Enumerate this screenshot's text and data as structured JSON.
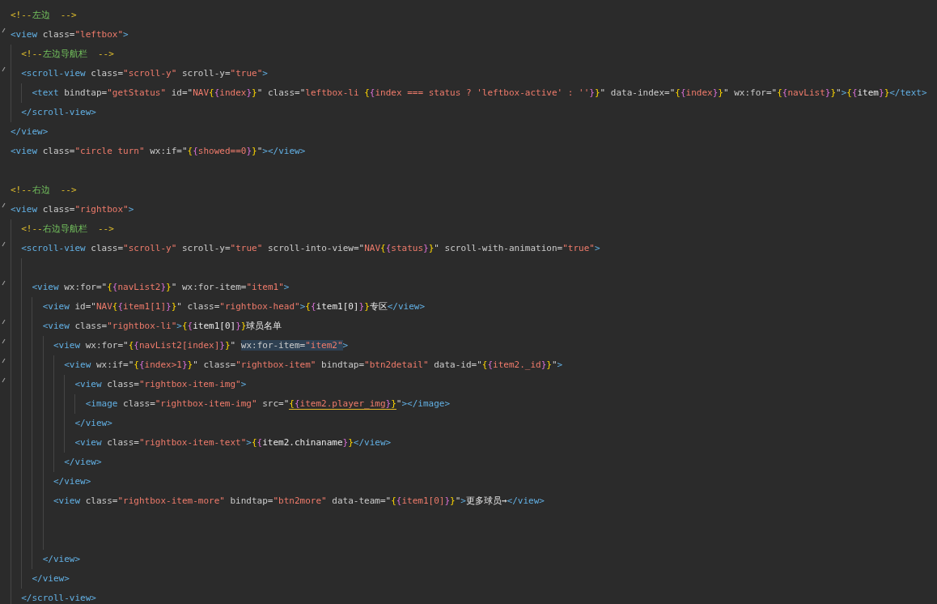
{
  "editor": {
    "lines": [
      {
        "gutter_mark": false,
        "tokens": [
          {
            "kind": "cm",
            "text": "<!--"
          },
          {
            "kind": "ct",
            "text": "左边"
          },
          {
            "kind": "cm",
            "text": "  -->"
          }
        ]
      },
      {
        "gutter_mark": true,
        "tokens": [
          {
            "kind": "tag",
            "text": "<view"
          },
          {
            "kind": "attr",
            "text": " class="
          },
          {
            "kind": "str",
            "text": "\"leftbox\""
          },
          {
            "kind": "tag",
            "text": ">"
          }
        ],
        "children": [
          {
            "gutter_mark": false,
            "tokens": [
              {
                "kind": "cm",
                "text": "<!--"
              },
              {
                "kind": "ct",
                "text": "左边导航栏"
              },
              {
                "kind": "cm",
                "text": "  -->"
              }
            ]
          },
          {
            "gutter_mark": true,
            "tokens": [
              {
                "kind": "tag",
                "text": "<scroll-view"
              },
              {
                "kind": "attr",
                "text": " class="
              },
              {
                "kind": "str",
                "text": "\"scroll-y\""
              },
              {
                "kind": "attr",
                "text": " scroll-y="
              },
              {
                "kind": "str",
                "text": "\"true\""
              },
              {
                "kind": "tag",
                "text": ">"
              }
            ],
            "children": [
              {
                "gutter_mark": false,
                "tokens": [
                  {
                    "kind": "tag",
                    "text": "<text"
                  },
                  {
                    "kind": "attr",
                    "text": " bindtap="
                  },
                  {
                    "kind": "str",
                    "text": "\"getStatus\""
                  },
                  {
                    "kind": "attr",
                    "text": " id=\""
                  },
                  {
                    "kind": "str",
                    "text": "NAV"
                  },
                  {
                    "kind": "open",
                    "text": "{{"
                  },
                  {
                    "kind": "str",
                    "text": "index"
                  },
                  {
                    "kind": "close",
                    "text": "}}"
                  },
                  {
                    "kind": "attr",
                    "text": "\" class=\""
                  },
                  {
                    "kind": "str",
                    "text": "leftbox-li "
                  },
                  {
                    "kind": "open",
                    "text": "{{"
                  },
                  {
                    "kind": "str",
                    "text": "index === status ? 'leftbox-active' : ''"
                  },
                  {
                    "kind": "close",
                    "text": "}}"
                  },
                  {
                    "kind": "attr",
                    "text": "\" data-index=\""
                  },
                  {
                    "kind": "open",
                    "text": "{{"
                  },
                  {
                    "kind": "str",
                    "text": "index"
                  },
                  {
                    "kind": "close",
                    "text": "}}"
                  },
                  {
                    "kind": "attr",
                    "text": "\" wx:for=\""
                  },
                  {
                    "kind": "open",
                    "text": "{{"
                  },
                  {
                    "kind": "str",
                    "text": "navList"
                  },
                  {
                    "kind": "close",
                    "text": "}}"
                  },
                  {
                    "kind": "attr",
                    "text": "\""
                  },
                  {
                    "kind": "tag",
                    "text": ">"
                  },
                  {
                    "kind": "open",
                    "text": "{{"
                  },
                  {
                    "kind": "text",
                    "text": "item"
                  },
                  {
                    "kind": "close",
                    "text": "}}"
                  },
                  {
                    "kind": "tag",
                    "text": "</text>"
                  }
                ]
              }
            ]
          },
          {
            "gutter_mark": false,
            "tokens": [
              {
                "kind": "tag",
                "text": "</scroll-view>"
              }
            ]
          }
        ]
      },
      {
        "gutter_mark": false,
        "tokens": [
          {
            "kind": "tag",
            "text": "</view>"
          }
        ]
      },
      {
        "gutter_mark": false,
        "tokens": [
          {
            "kind": "tag",
            "text": "<view"
          },
          {
            "kind": "attr",
            "text": " class="
          },
          {
            "kind": "str",
            "text": "\"circle turn\""
          },
          {
            "kind": "attr",
            "text": " wx:if=\""
          },
          {
            "kind": "open",
            "text": "{{"
          },
          {
            "kind": "str",
            "text": "showed==0"
          },
          {
            "kind": "close",
            "text": "}}"
          },
          {
            "kind": "attr",
            "text": "\""
          },
          {
            "kind": "tag",
            "text": "></view>"
          }
        ]
      },
      {
        "gutter_mark": false
      },
      {
        "gutter_mark": false,
        "tokens": [
          {
            "kind": "cm",
            "text": "<!--"
          },
          {
            "kind": "ct",
            "text": "右边"
          },
          {
            "kind": "cm",
            "text": "  -->"
          }
        ]
      },
      {
        "gutter_mark": true,
        "tokens": [
          {
            "kind": "tag",
            "text": "<view"
          },
          {
            "kind": "attr",
            "text": " class="
          },
          {
            "kind": "str",
            "text": "\"rightbox\""
          },
          {
            "kind": "tag",
            "text": ">"
          }
        ],
        "children": [
          {
            "gutter_mark": false,
            "tokens": [
              {
                "kind": "cm",
                "text": "<!--"
              },
              {
                "kind": "ct",
                "text": "右边导航栏"
              },
              {
                "kind": "cm",
                "text": "  -->"
              }
            ]
          },
          {
            "gutter_mark": true,
            "tokens": [
              {
                "kind": "tag",
                "text": "<scroll-view"
              },
              {
                "kind": "attr",
                "text": " class="
              },
              {
                "kind": "str",
                "text": "\"scroll-y\""
              },
              {
                "kind": "attr",
                "text": " scroll-y="
              },
              {
                "kind": "str",
                "text": "\"true\""
              },
              {
                "kind": "attr",
                "text": " scroll-into-view=\""
              },
              {
                "kind": "str",
                "text": "NAV"
              },
              {
                "kind": "open",
                "text": "{{"
              },
              {
                "kind": "str",
                "text": "status"
              },
              {
                "kind": "close",
                "text": "}}"
              },
              {
                "kind": "attr",
                "text": "\" scroll-with-animation="
              },
              {
                "kind": "str",
                "text": "\"true\""
              },
              {
                "kind": "tag",
                "text": ">"
              }
            ],
            "children": [
              {
                "gutter_mark": false
              },
              {
                "gutter_mark": true,
                "tokens": [
                  {
                    "kind": "tag",
                    "text": "<view"
                  },
                  {
                    "kind": "attr",
                    "text": " wx:for=\""
                  },
                  {
                    "kind": "open",
                    "text": "{{"
                  },
                  {
                    "kind": "str",
                    "text": "navList2"
                  },
                  {
                    "kind": "close",
                    "text": "}}"
                  },
                  {
                    "kind": "attr",
                    "text": "\" wx:for-item="
                  },
                  {
                    "kind": "str",
                    "text": "\"item1\""
                  },
                  {
                    "kind": "tag",
                    "text": ">"
                  }
                ],
                "children": [
                  {
                    "gutter_mark": false,
                    "tokens": [
                      {
                        "kind": "tag",
                        "text": "<view"
                      },
                      {
                        "kind": "attr",
                        "text": " id=\""
                      },
                      {
                        "kind": "str",
                        "text": "NAV"
                      },
                      {
                        "kind": "open",
                        "text": "{{"
                      },
                      {
                        "kind": "str",
                        "text": "item1[1]"
                      },
                      {
                        "kind": "close",
                        "text": "}}"
                      },
                      {
                        "kind": "attr",
                        "text": "\" class="
                      },
                      {
                        "kind": "str",
                        "text": "\"rightbox-head\""
                      },
                      {
                        "kind": "tag",
                        "text": ">"
                      },
                      {
                        "kind": "open",
                        "text": "{{"
                      },
                      {
                        "kind": "text",
                        "text": "item1[0]"
                      },
                      {
                        "kind": "close",
                        "text": "}}"
                      },
                      {
                        "kind": "text",
                        "text": "专区"
                      },
                      {
                        "kind": "tag",
                        "text": "</view>"
                      }
                    ]
                  },
                  {
                    "gutter_mark": true,
                    "tokens": [
                      {
                        "kind": "tag",
                        "text": "<view"
                      },
                      {
                        "kind": "attr",
                        "text": " class="
                      },
                      {
                        "kind": "str",
                        "text": "\"rightbox-li\""
                      },
                      {
                        "kind": "tag",
                        "text": ">"
                      },
                      {
                        "kind": "open",
                        "text": "{{"
                      },
                      {
                        "kind": "text",
                        "text": "item1[0]"
                      },
                      {
                        "kind": "close",
                        "text": "}}"
                      },
                      {
                        "kind": "text",
                        "text": "球员名单"
                      }
                    ],
                    "children": [
                      {
                        "gutter_mark": true,
                        "tokens": [
                          {
                            "kind": "tag",
                            "text": "<view"
                          },
                          {
                            "kind": "attr",
                            "text": " wx:for=\""
                          },
                          {
                            "kind": "open",
                            "text": "{{"
                          },
                          {
                            "kind": "str",
                            "text": "navList2[index]"
                          },
                          {
                            "kind": "close",
                            "text": "}}"
                          },
                          {
                            "kind": "attr",
                            "text": "\" "
                          },
                          {
                            "kind": "attr",
                            "text": "wx:for-item=",
                            "highlight": true
                          },
                          {
                            "kind": "str",
                            "text": "\"item2\"",
                            "highlight": true
                          },
                          {
                            "kind": "tag",
                            "text": ">"
                          }
                        ],
                        "children": [
                          {
                            "gutter_mark": true,
                            "tokens": [
                              {
                                "kind": "tag",
                                "text": "<view"
                              },
                              {
                                "kind": "attr",
                                "text": " wx:if=\""
                              },
                              {
                                "kind": "open",
                                "text": "{{"
                              },
                              {
                                "kind": "str",
                                "text": "index>1"
                              },
                              {
                                "kind": "close",
                                "text": "}}"
                              },
                              {
                                "kind": "attr",
                                "text": "\" class="
                              },
                              {
                                "kind": "str",
                                "text": "\"rightbox-item\""
                              },
                              {
                                "kind": "attr",
                                "text": " bindtap="
                              },
                              {
                                "kind": "str",
                                "text": "\"btn2detail\""
                              },
                              {
                                "kind": "attr",
                                "text": " data-id=\""
                              },
                              {
                                "kind": "open",
                                "text": "{{"
                              },
                              {
                                "kind": "str",
                                "text": "item2._id"
                              },
                              {
                                "kind": "close",
                                "text": "}}"
                              },
                              {
                                "kind": "attr",
                                "text": "\""
                              },
                              {
                                "kind": "tag",
                                "text": ">"
                              }
                            ],
                            "children": [
                              {
                                "gutter_mark": true,
                                "tokens": [
                                  {
                                    "kind": "tag",
                                    "text": "<view"
                                  },
                                  {
                                    "kind": "attr",
                                    "text": " class="
                                  },
                                  {
                                    "kind": "str",
                                    "text": "\"rightbox-item-img\""
                                  },
                                  {
                                    "kind": "tag",
                                    "text": ">"
                                  }
                                ],
                                "children": [
                                  {
                                    "gutter_mark": false,
                                    "tokens": [
                                      {
                                        "kind": "tag",
                                        "text": "<image"
                                      },
                                      {
                                        "kind": "attr",
                                        "text": " class="
                                      },
                                      {
                                        "kind": "str",
                                        "text": "\"rightbox-item-img\""
                                      },
                                      {
                                        "kind": "attr",
                                        "text": " src=\""
                                      },
                                      {
                                        "kind": "open",
                                        "text": "{{",
                                        "underline": true
                                      },
                                      {
                                        "kind": "str",
                                        "text": "item2.player_img",
                                        "underline": true
                                      },
                                      {
                                        "kind": "close",
                                        "text": "}}",
                                        "underline": true
                                      },
                                      {
                                        "kind": "attr",
                                        "text": "\""
                                      },
                                      {
                                        "kind": "tag",
                                        "text": "></image>"
                                      }
                                    ]
                                  }
                                ]
                              },
                              {
                                "gutter_mark": false,
                                "tokens": [
                                  {
                                    "kind": "tag",
                                    "text": "</view>"
                                  }
                                ]
                              },
                              {
                                "gutter_mark": false,
                                "tokens": [
                                  {
                                    "kind": "tag",
                                    "text": "<view"
                                  },
                                  {
                                    "kind": "attr",
                                    "text": " class="
                                  },
                                  {
                                    "kind": "str",
                                    "text": "\"rightbox-item-text\""
                                  },
                                  {
                                    "kind": "tag",
                                    "text": ">"
                                  },
                                  {
                                    "kind": "open",
                                    "text": "{{"
                                  },
                                  {
                                    "kind": "text",
                                    "text": "item2.chinaname"
                                  },
                                  {
                                    "kind": "close",
                                    "text": "}}"
                                  },
                                  {
                                    "kind": "tag",
                                    "text": "</view>"
                                  }
                                ]
                              }
                            ]
                          },
                          {
                            "gutter_mark": false,
                            "tokens": [
                              {
                                "kind": "tag",
                                "text": "</view>"
                              }
                            ]
                          }
                        ]
                      },
                      {
                        "gutter_mark": false,
                        "tokens": [
                          {
                            "kind": "tag",
                            "text": "</view>"
                          }
                        ]
                      },
                      {
                        "gutter_mark": false,
                        "tokens": [
                          {
                            "kind": "tag",
                            "text": "<view"
                          },
                          {
                            "kind": "attr",
                            "text": " class="
                          },
                          {
                            "kind": "str",
                            "text": "\"rightbox-item-more\""
                          },
                          {
                            "kind": "attr",
                            "text": " bindtap="
                          },
                          {
                            "kind": "str",
                            "text": "\"btn2more\""
                          },
                          {
                            "kind": "attr",
                            "text": " data-team=\""
                          },
                          {
                            "kind": "open",
                            "text": "{{"
                          },
                          {
                            "kind": "str",
                            "text": "item1[0]"
                          },
                          {
                            "kind": "close",
                            "text": "}}"
                          },
                          {
                            "kind": "attr",
                            "text": "\""
                          },
                          {
                            "kind": "tag",
                            "text": ">"
                          },
                          {
                            "kind": "text",
                            "text": "更多球员→"
                          },
                          {
                            "kind": "tag",
                            "text": "</view>"
                          }
                        ]
                      },
                      {
                        "gutter_mark": false
                      },
                      {
                        "gutter_mark": false
                      }
                    ]
                  },
                  {
                    "gutter_mark": false,
                    "tokens": [
                      {
                        "kind": "tag",
                        "text": "</view>"
                      }
                    ]
                  }
                ]
              },
              {
                "gutter_mark": false,
                "tokens": [
                  {
                    "kind": "tag",
                    "text": "</view>"
                  }
                ]
              }
            ]
          },
          {
            "gutter_mark": false,
            "tokens": [
              {
                "kind": "tag",
                "text": "</scroll-view>"
              }
            ]
          }
        ]
      }
    ]
  }
}
